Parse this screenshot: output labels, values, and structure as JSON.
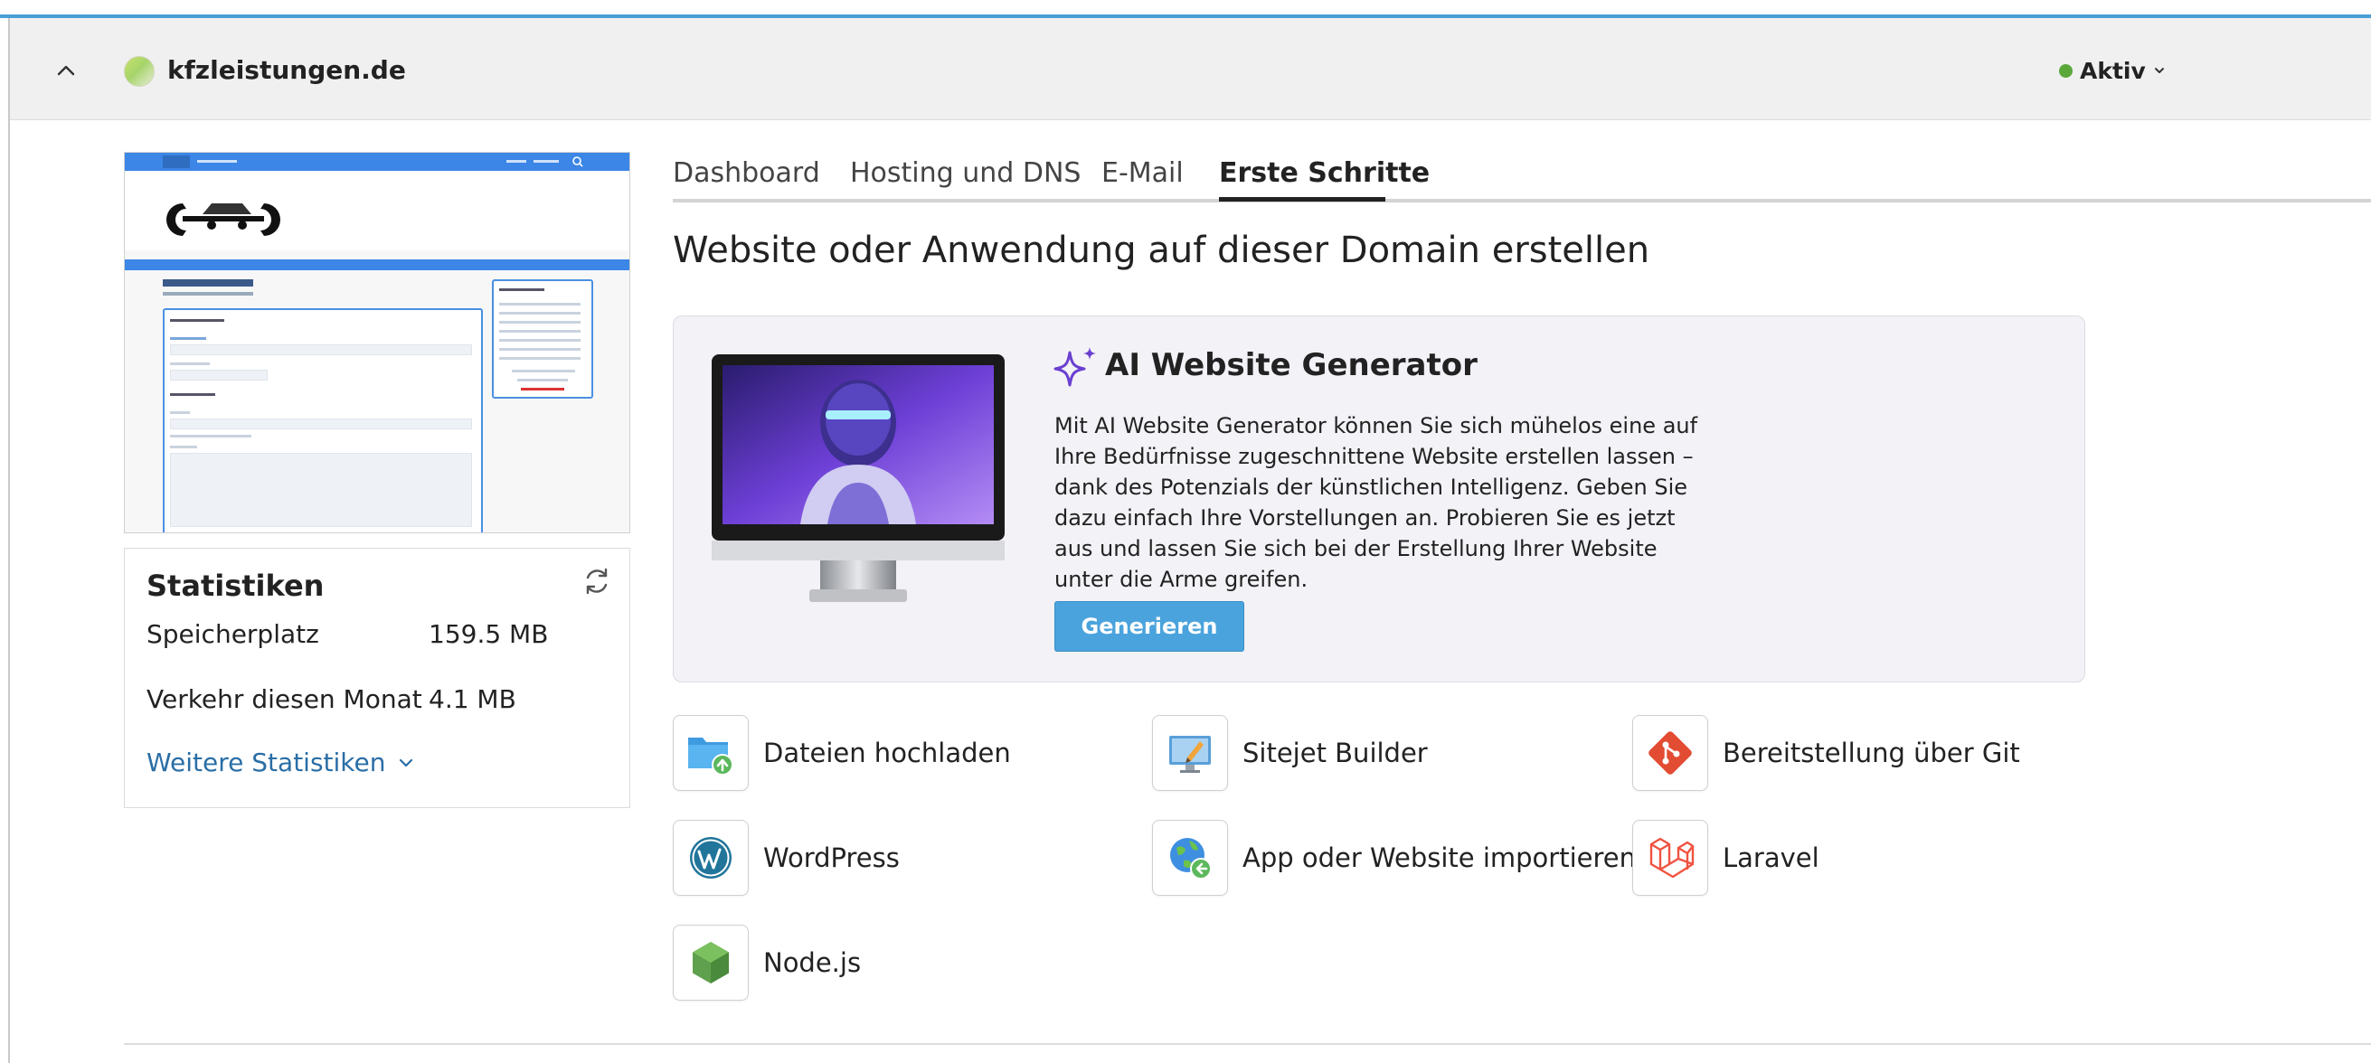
{
  "header": {
    "domain": "kfzleistungen.de",
    "status": "Aktiv",
    "status_color": "#5aa73a",
    "collapse_icon": "chevron-up-icon",
    "status_dropdown_icon": "chevron-down-icon"
  },
  "preview": {
    "site_heading": "KfZ-Serviceleistungen",
    "form_section_1": "Ihre Angaben",
    "form_section_2": "Ihre Anfrage",
    "side_box_title": "Öffnungszeiten"
  },
  "stats": {
    "title": "Statistiken",
    "refresh_icon": "refresh-icon",
    "rows": [
      {
        "label": "Speicherplatz",
        "value": "159.5 MB"
      },
      {
        "label": "Verkehr diesen Monat",
        "value": "4.1 MB"
      }
    ],
    "more_link": "Weitere Statistiken"
  },
  "tabs": [
    {
      "label": "Dashboard",
      "active": false
    },
    {
      "label": "Hosting und DNS",
      "active": false
    },
    {
      "label": "E-Mail",
      "active": false
    },
    {
      "label": "Erste Schritte",
      "active": true
    }
  ],
  "main": {
    "section_title": "Website oder Anwendung auf dieser Domain erstellen",
    "ai": {
      "title": "AI Website Generator",
      "description": "Mit AI Website Generator können Sie sich mühelos eine auf Ihre Bedürfnisse zugeschnittene Website erstellen lassen – dank des Potenzials der künstlichen Intelligenz. Geben Sie dazu einfach Ihre Vorstellungen an. Probieren Sie es jetzt aus und lassen Sie sich bei der Erstellung Ihrer Website unter die Arme greifen.",
      "button": "Generieren",
      "accent_color": "#6a3fd0",
      "button_color": "#4aa3dc"
    },
    "actions": [
      {
        "label": "Dateien hochladen",
        "icon": "folder-upload-icon"
      },
      {
        "label": "Sitejet Builder",
        "icon": "sitejet-builder-icon"
      },
      {
        "label": "Bereitstellung über Git",
        "icon": "git-icon"
      },
      {
        "label": "WordPress",
        "icon": "wordpress-icon"
      },
      {
        "label": "App oder Website importieren",
        "icon": "globe-import-icon"
      },
      {
        "label": "Laravel",
        "icon": "laravel-icon"
      },
      {
        "label": "Node.js",
        "icon": "nodejs-icon"
      }
    ]
  }
}
